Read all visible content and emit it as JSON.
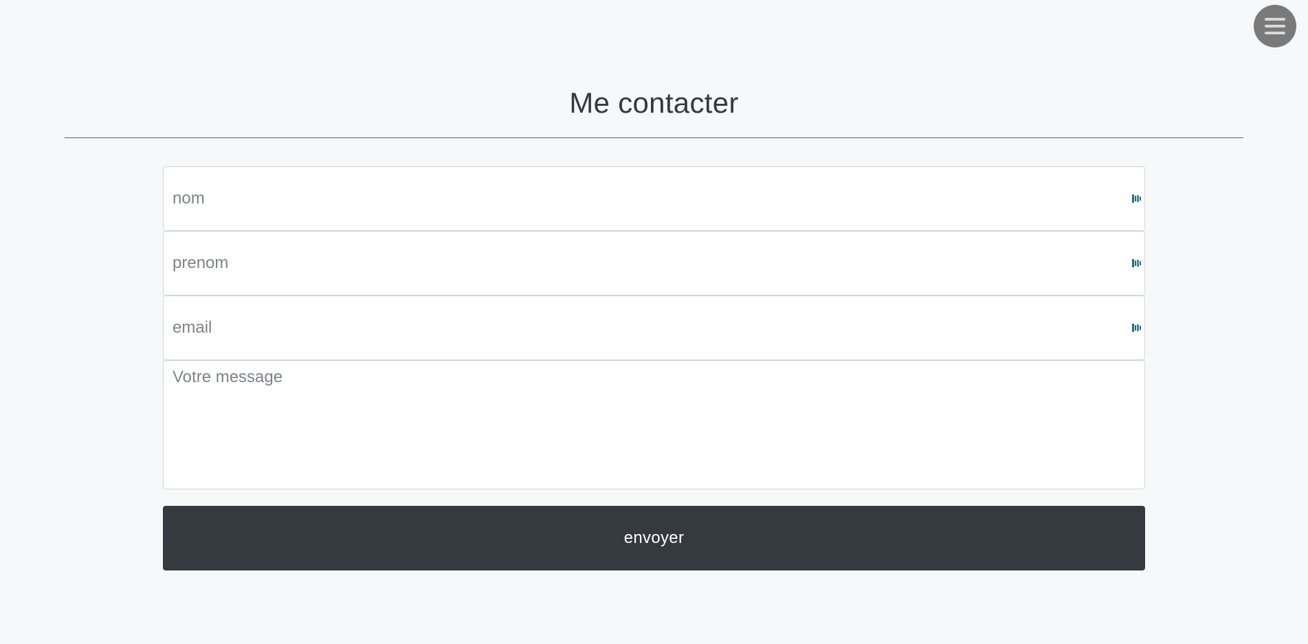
{
  "header": {
    "menu_icon": "hamburger-menu-icon",
    "title": "Me contacter"
  },
  "form": {
    "fields": [
      {
        "name": "nom",
        "placeholder": "nom",
        "value": ""
      },
      {
        "name": "prenom",
        "placeholder": "prenom",
        "value": ""
      },
      {
        "name": "email",
        "placeholder": "email",
        "value": ""
      }
    ],
    "message": {
      "placeholder": "Votre message",
      "value": ""
    },
    "field_icon": "autofill-extension-icon",
    "submit_label": "envoyer"
  },
  "colors": {
    "background": "#f7f8f9",
    "title_text": "#343a40",
    "button_background": "#343a40",
    "button_text": "#ffffff",
    "menu_circle": "#7a7a7a",
    "field_icon": "#2a6a78"
  }
}
